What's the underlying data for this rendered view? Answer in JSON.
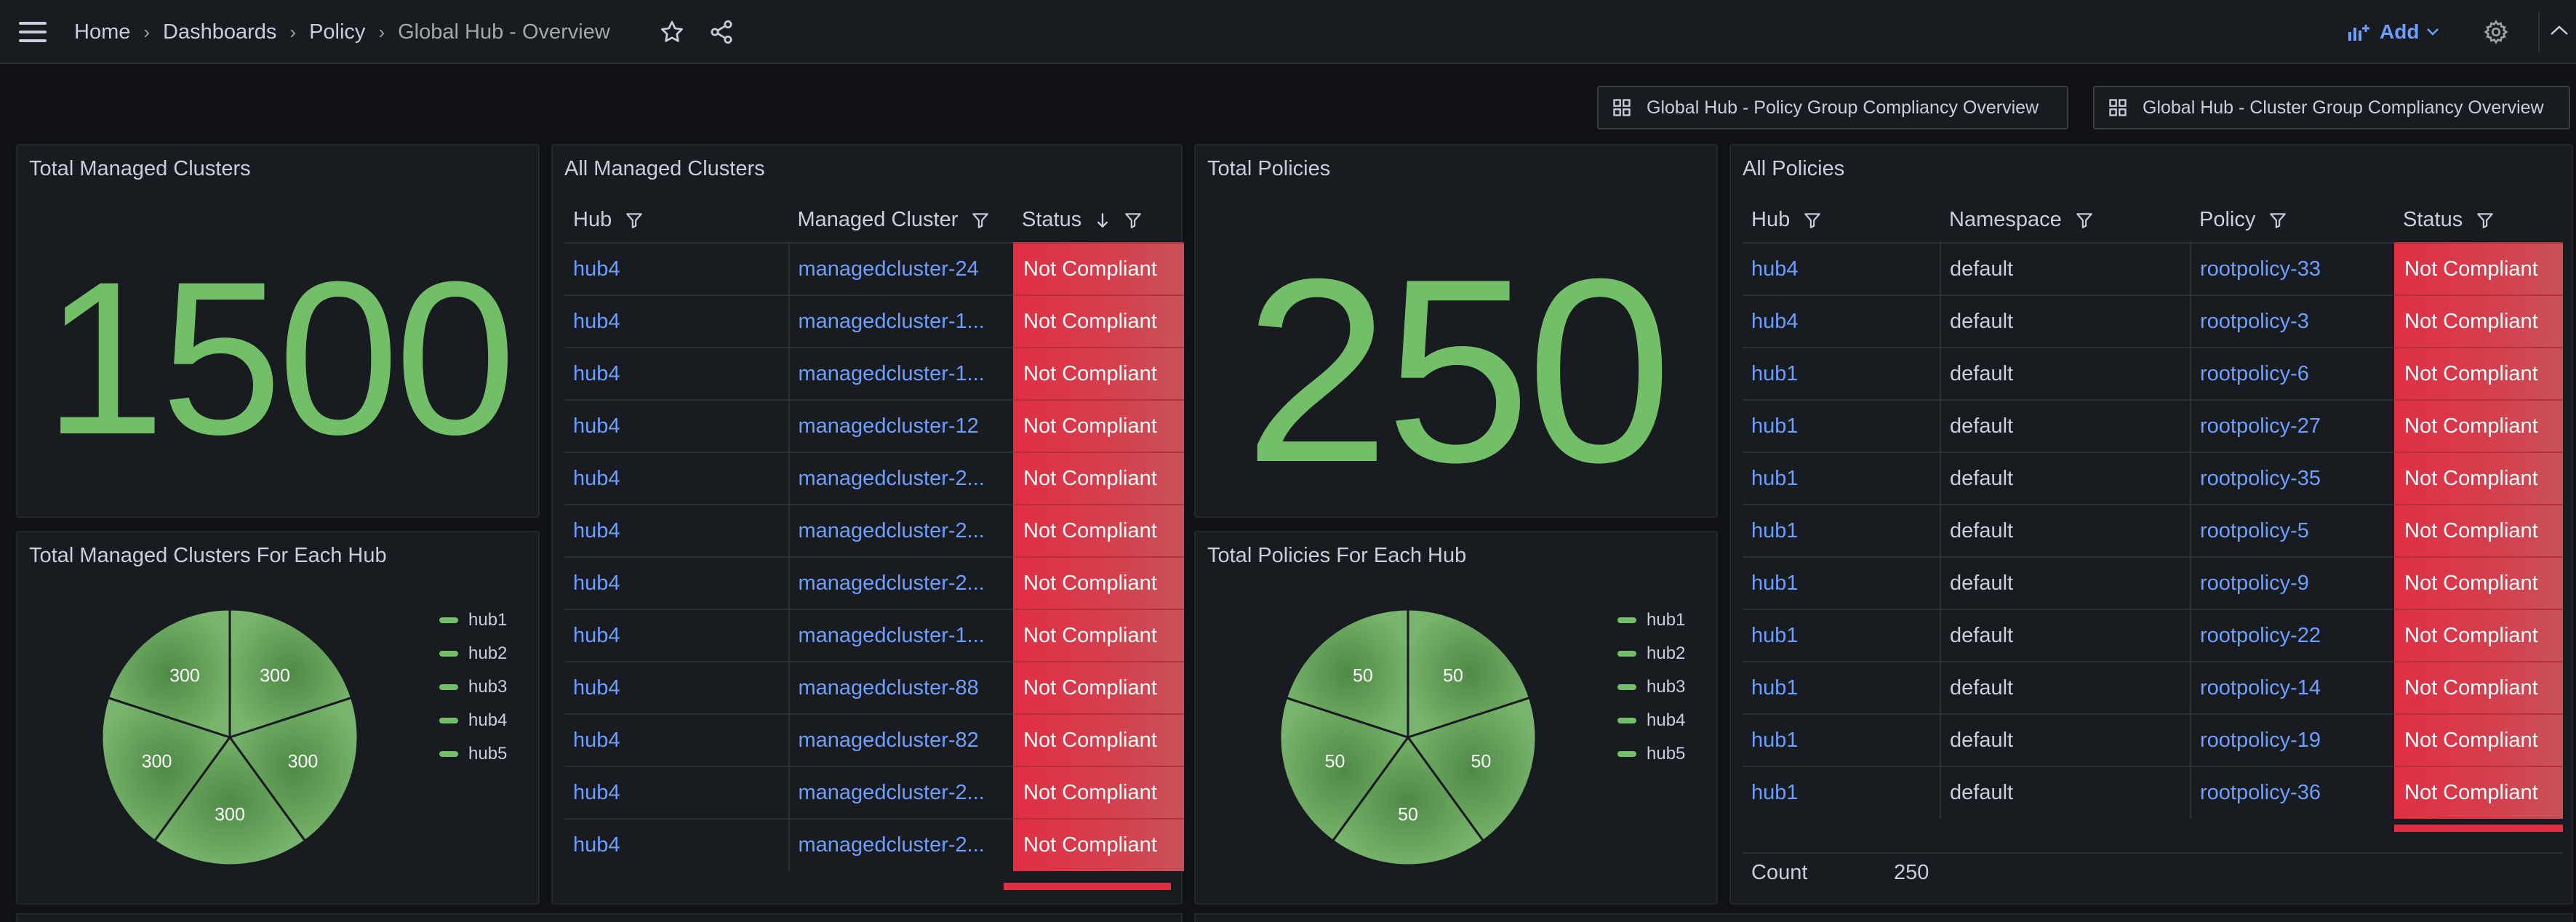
{
  "breadcrumb": [
    "Home",
    "Dashboards",
    "Policy",
    "Global Hub - Overview"
  ],
  "toolbar": {
    "add_label": "Add"
  },
  "dashboard_links": [
    "Global Hub - Policy Group Compliancy Overview",
    "Global Hub - Cluster Group Compliancy Overview"
  ],
  "panels": {
    "total_clusters": {
      "title": "Total Managed Clusters",
      "value": "1500"
    },
    "clusters_per_hub": {
      "title": "Total Managed Clusters For Each Hub",
      "legend": [
        "hub1",
        "hub2",
        "hub3",
        "hub4",
        "hub5"
      ],
      "values": [
        300,
        300,
        300,
        300,
        300
      ],
      "labels": [
        "300",
        "300",
        "300",
        "300",
        "300"
      ]
    },
    "all_clusters": {
      "title": "All Managed Clusters",
      "headers": [
        "Hub",
        "Managed Cluster",
        "Status"
      ],
      "rows": [
        [
          "hub4",
          "managedcluster-24",
          "Not Compliant"
        ],
        [
          "hub4",
          "managedcluster-1...",
          "Not Compliant"
        ],
        [
          "hub4",
          "managedcluster-1...",
          "Not Compliant"
        ],
        [
          "hub4",
          "managedcluster-12",
          "Not Compliant"
        ],
        [
          "hub4",
          "managedcluster-2...",
          "Not Compliant"
        ],
        [
          "hub4",
          "managedcluster-2...",
          "Not Compliant"
        ],
        [
          "hub4",
          "managedcluster-2...",
          "Not Compliant"
        ],
        [
          "hub4",
          "managedcluster-1...",
          "Not Compliant"
        ],
        [
          "hub4",
          "managedcluster-88",
          "Not Compliant"
        ],
        [
          "hub4",
          "managedcluster-82",
          "Not Compliant"
        ],
        [
          "hub4",
          "managedcluster-2...",
          "Not Compliant"
        ],
        [
          "hub4",
          "managedcluster-2...",
          "Not Compliant"
        ]
      ]
    },
    "total_policies": {
      "title": "Total Policies",
      "value": "250"
    },
    "policies_per_hub": {
      "title": "Total Policies For Each Hub",
      "legend": [
        "hub1",
        "hub2",
        "hub3",
        "hub4",
        "hub5"
      ],
      "values": [
        50,
        50,
        50,
        50,
        50
      ],
      "labels": [
        "50",
        "50",
        "50",
        "50",
        "50"
      ]
    },
    "all_policies": {
      "title": "All Policies",
      "headers": [
        "Hub",
        "Namespace",
        "Policy",
        "Status"
      ],
      "rows": [
        [
          "hub4",
          "default",
          "rootpolicy-33",
          "Not Compliant"
        ],
        [
          "hub4",
          "default",
          "rootpolicy-3",
          "Not Compliant"
        ],
        [
          "hub1",
          "default",
          "rootpolicy-6",
          "Not Compliant"
        ],
        [
          "hub1",
          "default",
          "rootpolicy-27",
          "Not Compliant"
        ],
        [
          "hub1",
          "default",
          "rootpolicy-35",
          "Not Compliant"
        ],
        [
          "hub1",
          "default",
          "rootpolicy-5",
          "Not Compliant"
        ],
        [
          "hub1",
          "default",
          "rootpolicy-9",
          "Not Compliant"
        ],
        [
          "hub1",
          "default",
          "rootpolicy-22",
          "Not Compliant"
        ],
        [
          "hub1",
          "default",
          "rootpolicy-14",
          "Not Compliant"
        ],
        [
          "hub1",
          "default",
          "rootpolicy-19",
          "Not Compliant"
        ],
        [
          "hub1",
          "default",
          "rootpolicy-36",
          "Not Compliant"
        ]
      ],
      "footer": {
        "label": "Count",
        "value": "250"
      }
    }
  },
  "colors": {
    "stat_green": "#73bf69",
    "status_red": "#e02f44",
    "link_blue": "#6e9fff",
    "panel_bg": "#181b1f",
    "page_bg": "#111217"
  },
  "icons": [
    "menu-icon",
    "star-icon",
    "share-icon",
    "add-panel-icon",
    "chevron-down-icon",
    "gear-icon",
    "collapse-icon",
    "dashboard-grid-icon",
    "filter-icon",
    "sort-desc-icon"
  ]
}
